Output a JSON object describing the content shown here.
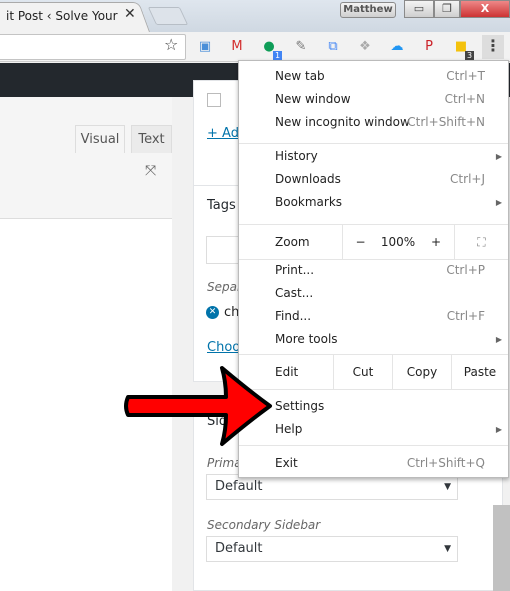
{
  "browser": {
    "tab_title": "it Post ‹ Solve Your Te",
    "profile_name": "Matthew",
    "extensions": [
      {
        "icon": "screenshot-icon",
        "color": "#4a8fd8"
      },
      {
        "icon": "gmail-icon",
        "color": "#d32f2f"
      },
      {
        "icon": "hangouts-icon",
        "color": "#0f9d58",
        "badge": "1"
      },
      {
        "icon": "pen-icon",
        "color": "#777"
      },
      {
        "icon": "bracket-icon",
        "color": "#4285f4"
      },
      {
        "icon": "dropbox-icon",
        "color": "#aaa"
      },
      {
        "icon": "cloud-icon",
        "color": "#2196f3"
      },
      {
        "icon": "pinterest-icon",
        "color": "#cb2027"
      },
      {
        "icon": "chat-icon",
        "color": "#f4c20d",
        "badge": "3"
      }
    ]
  },
  "editor": {
    "tabs": [
      "Visual",
      "Text"
    ]
  },
  "sidebar": {
    "add_link": "+ Add",
    "tags_title": "Tags",
    "separate_hint": "Separ",
    "tag": "ch",
    "choose_link": "Choo",
    "sidebar_title": "Sid",
    "primary_label": "Prima",
    "primary_value": "Default",
    "secondary_label": "Secondary Sidebar",
    "secondary_value": "Default"
  },
  "menu": {
    "group1": [
      {
        "label": "New tab",
        "shortcut": "Ctrl+T"
      },
      {
        "label": "New window",
        "shortcut": "Ctrl+N"
      },
      {
        "label": "New incognito window",
        "shortcut": "Ctrl+Shift+N"
      }
    ],
    "group2": [
      {
        "label": "History",
        "shortcut": ""
      },
      {
        "label": "Downloads",
        "shortcut": "Ctrl+J"
      },
      {
        "label": "Bookmarks",
        "shortcut": ""
      }
    ],
    "zoom": {
      "label": "Zoom",
      "minus": "−",
      "value": "100%",
      "plus": "+"
    },
    "group3": [
      {
        "label": "Print...",
        "shortcut": "Ctrl+P"
      },
      {
        "label": "Cast...",
        "shortcut": ""
      },
      {
        "label": "Find...",
        "shortcut": "Ctrl+F"
      },
      {
        "label": "More tools",
        "shortcut": ""
      }
    ],
    "edit": {
      "label": "Edit",
      "cut": "Cut",
      "copy": "Copy",
      "paste": "Paste"
    },
    "group4": [
      {
        "label": "Settings"
      },
      {
        "label": "Help"
      }
    ],
    "exit": {
      "label": "Exit",
      "shortcut": "Ctrl+Shift+Q"
    }
  },
  "annotation": {
    "arrow_color": "#ff0000"
  }
}
